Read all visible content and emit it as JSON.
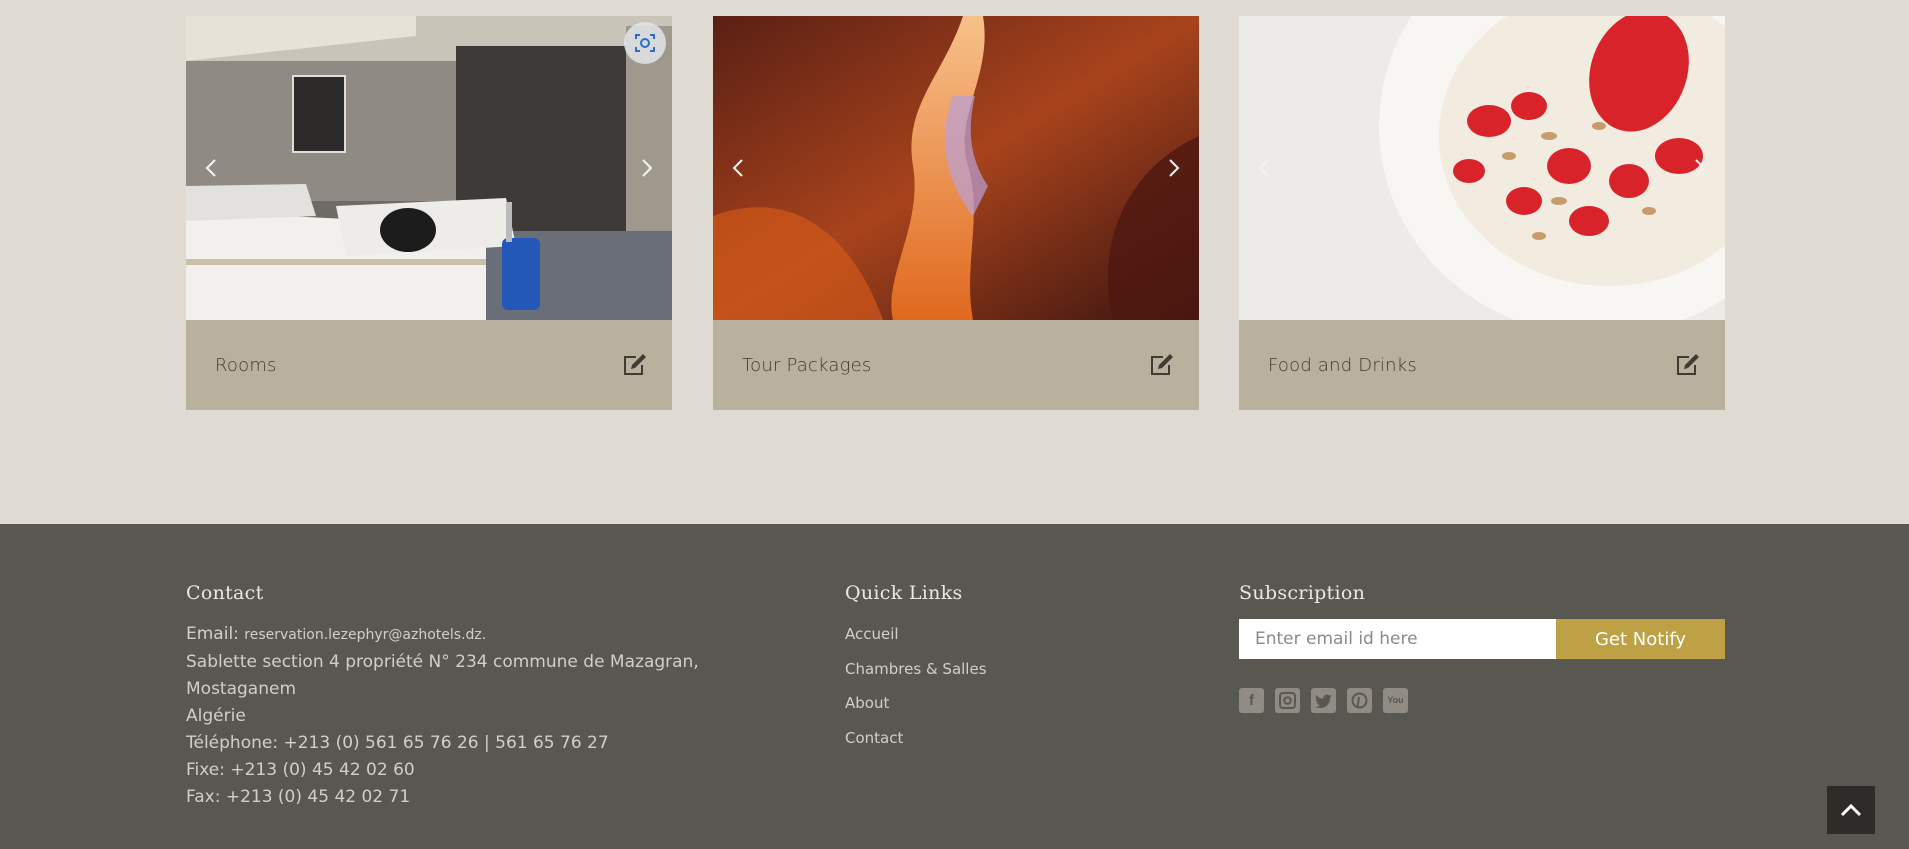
{
  "cards": [
    {
      "title": "Rooms",
      "image": "hotel-room-photo",
      "edit_icon": "edit-icon"
    },
    {
      "title": "Tour Packages",
      "image": "canyon-photo",
      "edit_icon": "edit-icon"
    },
    {
      "title": "Food and Drinks",
      "image": "strawberry-yogurt-photo",
      "edit_icon": "edit-icon"
    }
  ],
  "footer": {
    "contact": {
      "heading": "Contact",
      "email_label": "Email: ",
      "email_value": "reservation.lezephyr@azhotels.dz.",
      "address_line1": "Sablette section 4 propriété N° 234 commune de Mazagran,",
      "address_line2": "Mostaganem",
      "country": "Algérie",
      "telephone": "Téléphone: +213 (0) 561 65 76 26 | 561 65 76 27",
      "fixe": "Fixe: +213 (0) 45 42 02 60",
      "fax": "Fax: +213 (0) 45 42 02 71"
    },
    "quick_links": {
      "heading": "Quick Links",
      "items": [
        "Accueil",
        "Chambres & Salles",
        "About",
        "Contact"
      ]
    },
    "subscription": {
      "heading": "Subscription",
      "placeholder": "Enter email id here",
      "button_label": "Get Notify",
      "socials": [
        "facebook-icon",
        "instagram-icon",
        "twitter-icon",
        "pinterest-icon",
        "youtube-icon"
      ]
    }
  },
  "colors": {
    "page_bg": "#dfdbd2",
    "card_caption_bg": "#b9b09e",
    "footer_bg": "#595751",
    "button_bg": "#bda144"
  }
}
